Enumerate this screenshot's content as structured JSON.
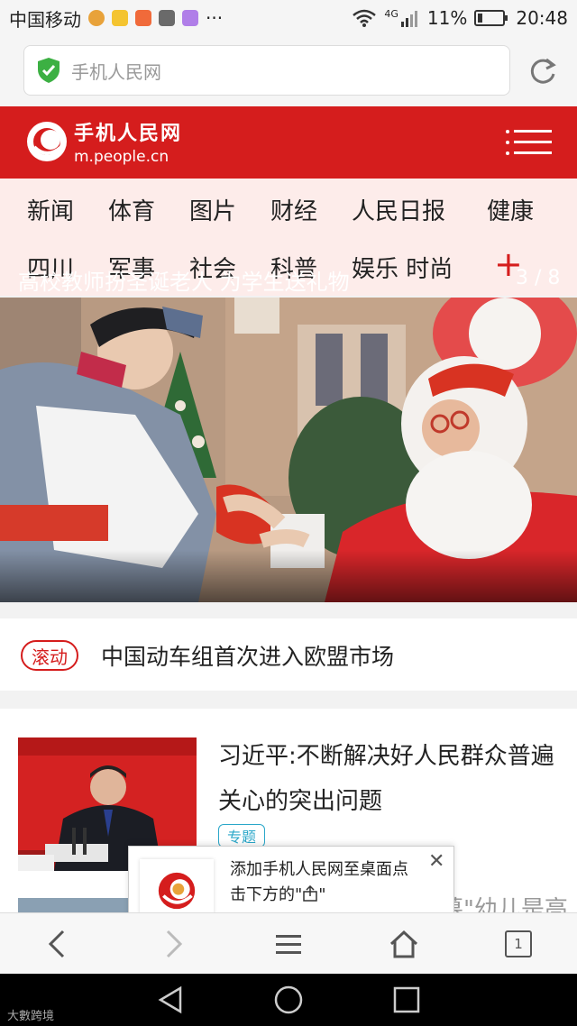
{
  "status_bar": {
    "carrier": "中国移动",
    "more": "···",
    "network": "4G",
    "battery": "11%",
    "time": "20:48"
  },
  "browser": {
    "url_text": "手机人民网"
  },
  "site_header": {
    "logo_cn": "手机人民网",
    "logo_en": "m.people.cn"
  },
  "nav": {
    "row1": [
      "新闻",
      "体育",
      "图片",
      "财经",
      "人民日报",
      "健康"
    ],
    "row2": [
      "四川",
      "军事",
      "社会",
      "科普",
      "娱乐 时尚"
    ],
    "plus": "+"
  },
  "hero": {
    "caption": "高校教师扮圣诞老人 为学生送礼物",
    "counter": "3 / 8"
  },
  "scroll": {
    "badge": "滚动",
    "text": "中国动车组首次进入欧盟市场"
  },
  "news": [
    {
      "title": "习近平:不断解决好人民群众普遍关心的突出问题",
      "tag": "专题"
    },
    {
      "title": "是鲁选择\"添加至主屏幕\"幼儿是高"
    }
  ],
  "popup": {
    "text_line1": "添加手机人民网至桌面点",
    "text_line2": "击下方的\"",
    "text_line2b": "\"",
    "close": "✕"
  },
  "toolbar": {
    "tab_count": "1"
  },
  "watermark": "大數跨境",
  "colors": {
    "brand_red": "#d51d1d",
    "nav_bg": "#fdecea",
    "tag_blue": "#2aa7c9"
  }
}
